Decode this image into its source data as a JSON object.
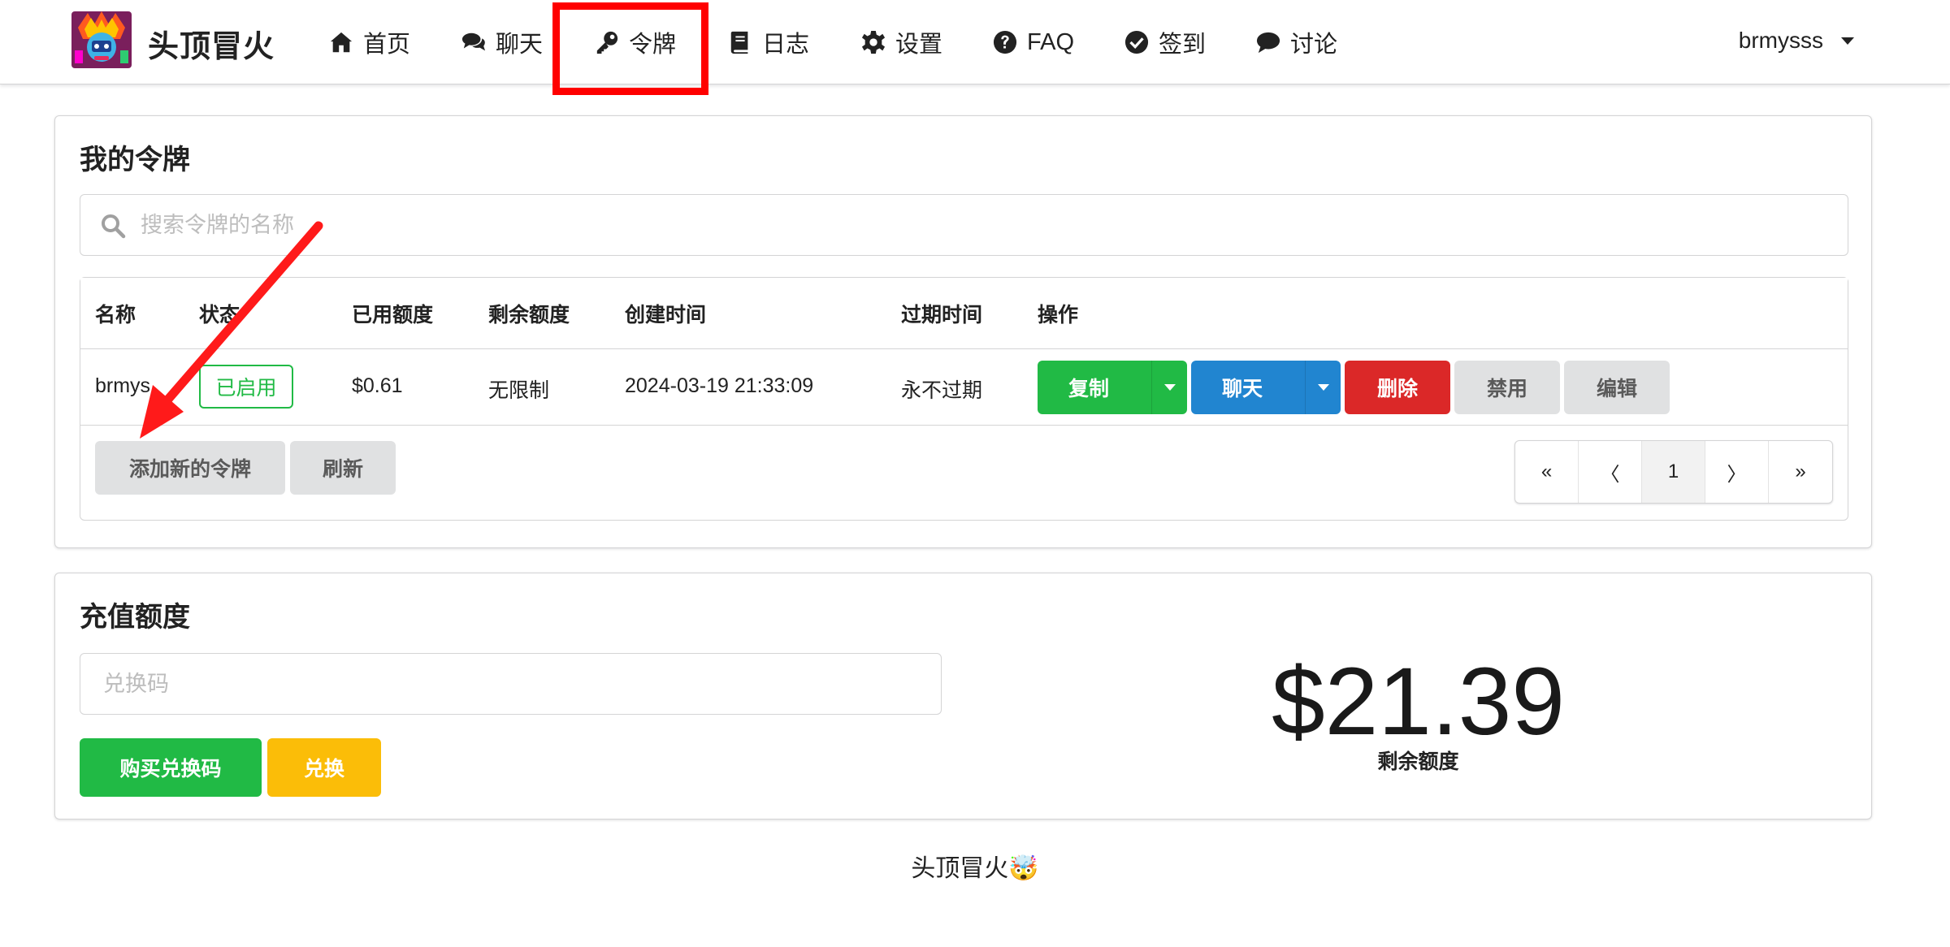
{
  "nav": {
    "brand": "头顶冒火",
    "items": [
      {
        "label": "首页",
        "icon": "home-icon"
      },
      {
        "label": "聊天",
        "icon": "comments-icon"
      },
      {
        "label": "令牌",
        "icon": "key-icon"
      },
      {
        "label": "日志",
        "icon": "book-icon"
      },
      {
        "label": "设置",
        "icon": "gear-icon"
      },
      {
        "label": "FAQ",
        "icon": "question-circle-icon"
      },
      {
        "label": "签到",
        "icon": "check-circle-icon"
      },
      {
        "label": "讨论",
        "icon": "comment-icon"
      }
    ],
    "user": "brmysss",
    "active": "令牌"
  },
  "tokens": {
    "title": "我的令牌",
    "search_placeholder": "搜索令牌的名称",
    "columns": [
      "名称",
      "状态",
      "已用额度",
      "剩余额度",
      "创建时间",
      "过期时间",
      "操作"
    ],
    "rows": [
      {
        "name": "brmys",
        "status": "已启用",
        "used": "$0.61",
        "remaining": "无限制",
        "created": "2024-03-19 21:33:09",
        "expires": "永不过期",
        "actions": {
          "copy": "复制",
          "chat": "聊天",
          "delete": "删除",
          "disable": "禁用",
          "edit": "编辑"
        }
      }
    ],
    "add_button": "添加新的令牌",
    "refresh_button": "刷新",
    "pagination": {
      "first": "«",
      "prev": "〈",
      "current": "1",
      "next": "〉",
      "last": "»"
    }
  },
  "topup": {
    "title": "充值额度",
    "code_placeholder": "兑换码",
    "buy_button": "购买兑换码",
    "redeem_button": "兑换",
    "quota_value": "$21.39",
    "quota_label": "剩余额度"
  },
  "footer": {
    "text": "头顶冒火",
    "emoji": "🤯"
  },
  "colors": {
    "green": "#21ba45",
    "blue": "#2185d0",
    "red": "#db2828",
    "yellow": "#fbbd08",
    "annotation": "#ff0000"
  }
}
